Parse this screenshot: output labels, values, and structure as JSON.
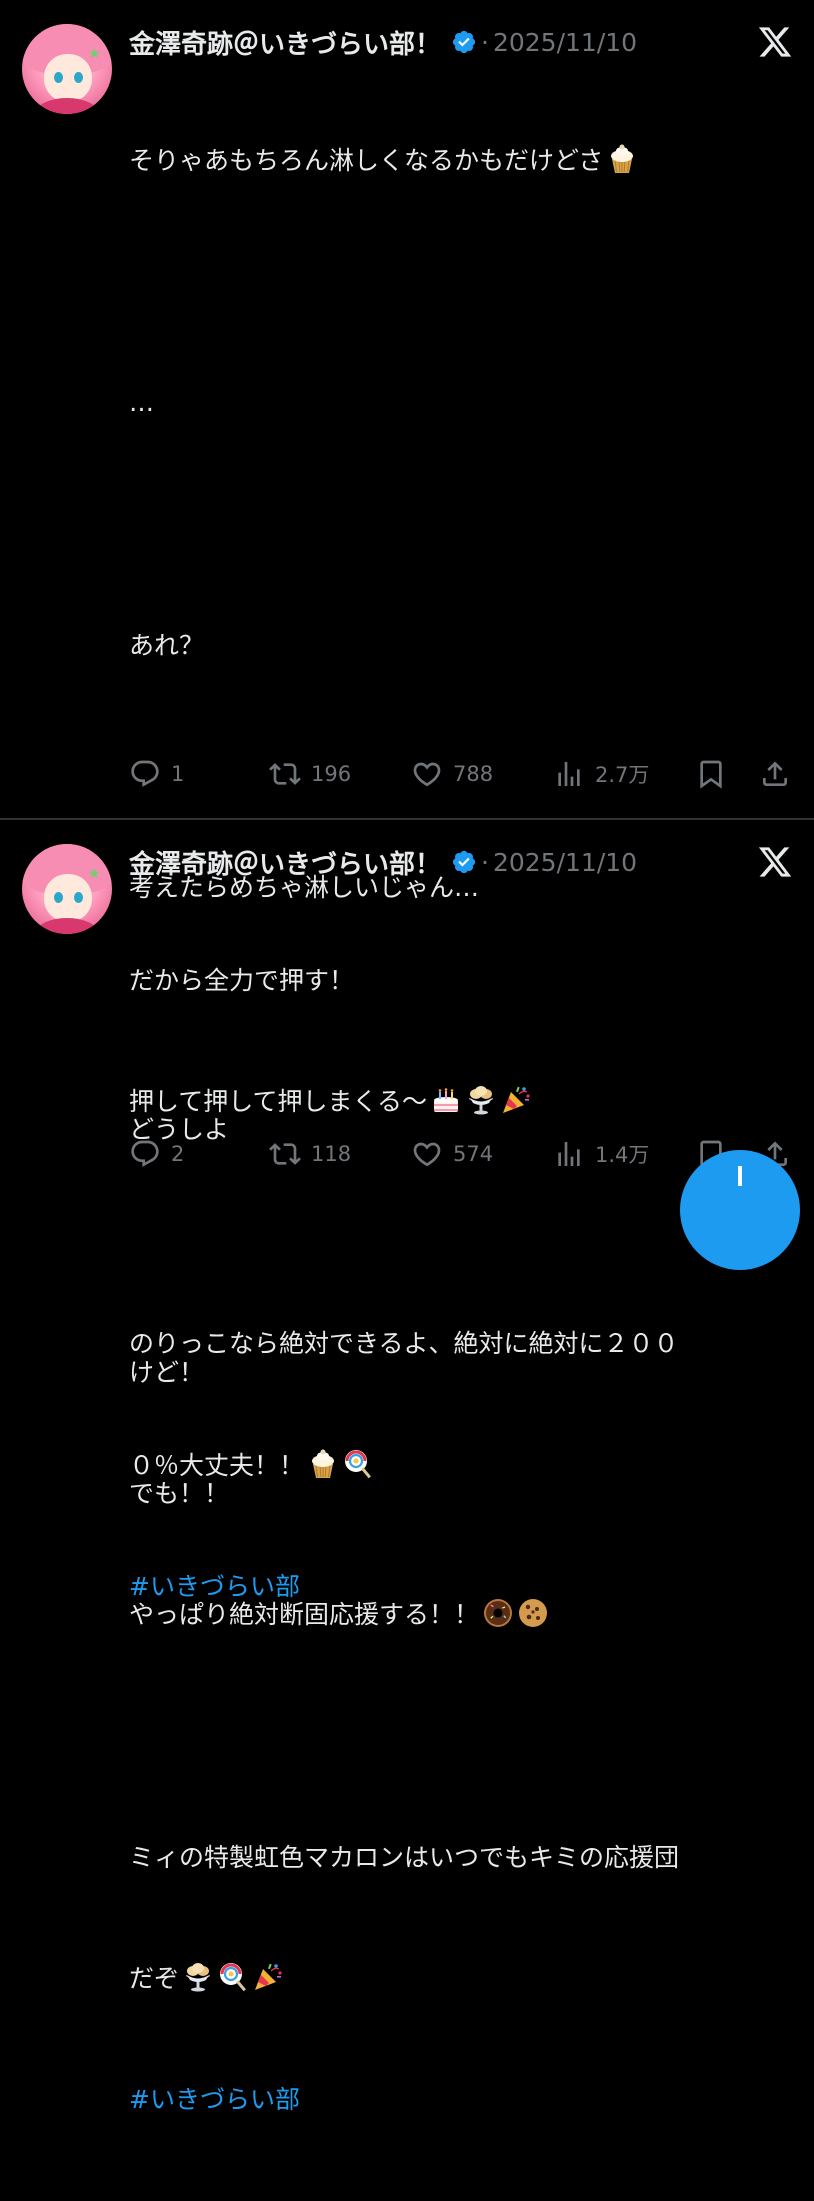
{
  "colors": {
    "background": "#000000",
    "text": "#e7e9ea",
    "muted": "#71767b",
    "accent": "#1d9bf0",
    "separator": "#2f3336"
  },
  "tweets": [
    {
      "author": "金澤奇跡＠いきづらい部！",
      "date": "2025/11/10",
      "separator": "·",
      "lines": [
        "そりゃあもちろん淋しくなるかもだけどさ",
        "",
        "…",
        "",
        "あれ？",
        "",
        "考えたらめちゃ淋しいじゃん…",
        "",
        "どうしよ",
        "",
        "けど！",
        "でも！！",
        "やっぱり絶対断固応援する！！",
        "",
        "ミィの特製虹色マカロンはいつでもキミの応援団",
        "だぞ"
      ],
      "hashtag": "#いきづらい部",
      "stats": {
        "replies": "1",
        "reposts": "196",
        "likes": "788",
        "views": "2.7万"
      }
    },
    {
      "author": "金澤奇跡＠いきづらい部！",
      "date": "2025/11/10",
      "separator": "·",
      "lines": [
        "だから全力で押す！",
        "押して押して押しまくる〜",
        "",
        "のりっこなら絶対できるよ、絶対に絶対に２００",
        "０％大丈夫！！"
      ],
      "hashtag": "#いきづらい部",
      "stats": {
        "replies": "2",
        "reposts": "118",
        "likes": "574",
        "views": "1.4万"
      }
    }
  ],
  "icons": {
    "verified": "verified-badge-icon",
    "platform": "x-logo-icon",
    "reply": "reply-icon",
    "repost": "repost-icon",
    "like": "heart-icon",
    "views": "views-icon",
    "bookmark": "bookmark-icon",
    "share": "share-icon",
    "compose": "compose-fab"
  }
}
